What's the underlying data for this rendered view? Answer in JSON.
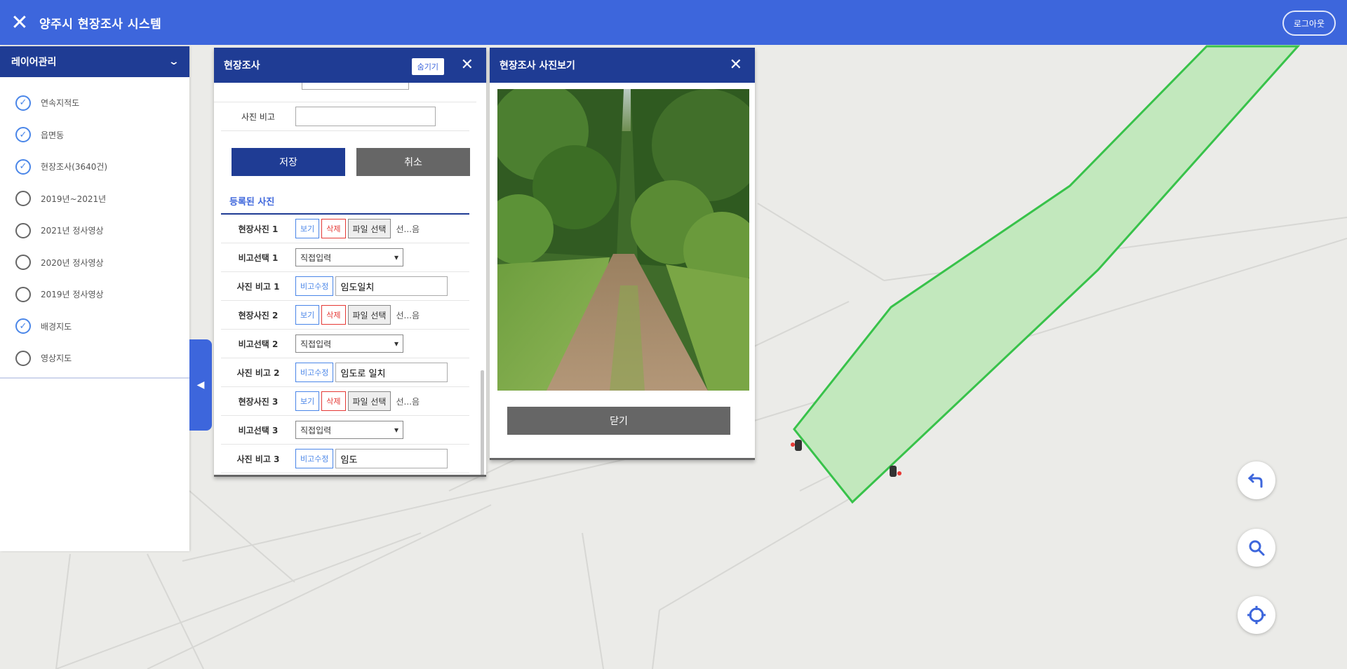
{
  "header": {
    "title": "양주시 현장조사 시스템",
    "logout_label": "로그아웃"
  },
  "layers": {
    "title": "레이어관리",
    "items": [
      {
        "label": "연속지적도",
        "checked": true
      },
      {
        "label": "읍면동",
        "checked": true
      },
      {
        "label": "현장조사(3640건)",
        "checked": true
      },
      {
        "label": "2019년~2021년",
        "checked": false
      },
      {
        "label": "2021년 정사영상",
        "checked": false
      },
      {
        "label": "2020년 정사영상",
        "checked": false
      },
      {
        "label": "2019년 정사영상",
        "checked": false
      },
      {
        "label": "배경지도",
        "checked": true
      },
      {
        "label": "영상지도",
        "checked": false
      }
    ]
  },
  "survey": {
    "title": "현장조사",
    "hide_label": "숨기기",
    "photo_note_label": "사진 비고",
    "photo_note_value": "",
    "save_label": "저장",
    "cancel_label": "취소",
    "section_title": "등록된 사진",
    "view_label": "보기",
    "delete_label": "삭제",
    "file_label": "파일 선택",
    "file_status": "선...음",
    "note_edit_label": "비고수정",
    "photos": [
      {
        "photo_label": "현장사진 1",
        "select_label": "비고선택 1",
        "select_value": "직접입력",
        "note_label": "사진 비고 1",
        "note_value": "임도일치"
      },
      {
        "photo_label": "현장사진 2",
        "select_label": "비고선택 2",
        "select_value": "직접입력",
        "note_label": "사진 비고 2",
        "note_value": "임도로 일치"
      },
      {
        "photo_label": "현장사진 3",
        "select_label": "비고선택 3",
        "select_value": "직접입력",
        "note_label": "사진 비고 3",
        "note_value": "임도"
      }
    ]
  },
  "viewer": {
    "title": "현장조사 사진보기",
    "close_label": "닫기"
  },
  "colors": {
    "header": "#3d66dc",
    "panel_head": "#1f3c94",
    "parcel_fill": "#c2e8bd",
    "parcel_stroke": "#38c24a"
  }
}
